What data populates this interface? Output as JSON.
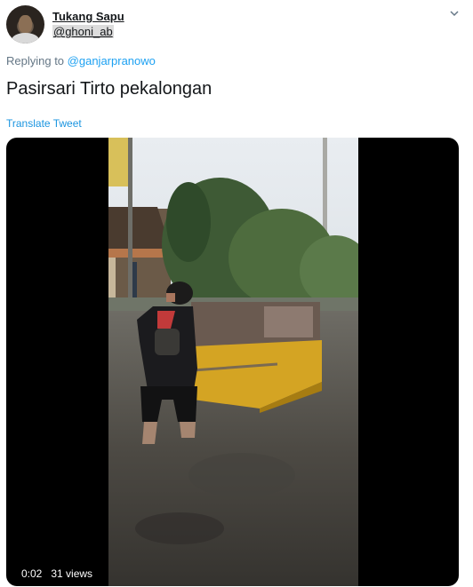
{
  "user": {
    "display_name": "Tukang Sapu",
    "handle": "@ghoni_ab"
  },
  "reply": {
    "prefix": "Replying to",
    "mention": "@ganjarpranowo"
  },
  "tweet": {
    "text": "Pasirsari Tirto pekalongan",
    "translate_label": "Translate Tweet"
  },
  "video": {
    "time": "0:02",
    "views": "31 views"
  },
  "icons": {
    "menu": "chevron-down-icon"
  }
}
